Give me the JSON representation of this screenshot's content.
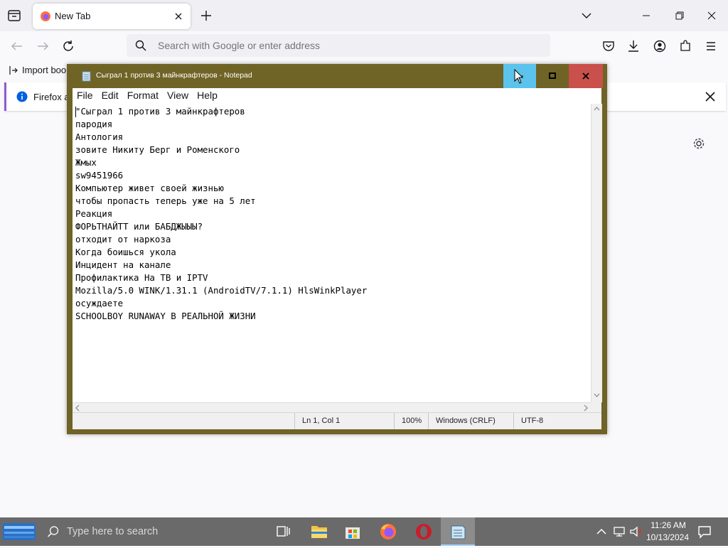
{
  "browser": {
    "tab_title": "New Tab",
    "search_placeholder": "Search with Google or enter address",
    "bookmarks_import_label": "Import bookmarks...",
    "bookmarks_import_visible": "Import boo",
    "notification_text": "Firefox au",
    "accent_color": "#8f5bd0"
  },
  "notepad": {
    "title": "Сыграл 1 против 3 майнкрафтеров - Notepad",
    "menus": [
      "File",
      "Edit",
      "Format",
      "View",
      "Help"
    ],
    "content": "\"Сыграл 1 против 3 майнкрафтеров\nпародия\nАнтология\nзовите Никиту Берг и Роменского\nЖмых\nsw9451966\nКомпьютер живет своей жизнью\nчтобы пропасть теперь уже на 5 лет\nРеакция\nФОРЬТНАЙТТ или БАБДЖЫЫЫ?\nотходит от наркоза\nКогда боишься укола\nИнцидент на канале\nПрофилактика На ТВ и IPTV\nMozilla/5.0 WINK/1.31.1 (AndroidTV/7.1.1) HlsWinkPlayer\nосуждаете\nSCHOOLBOY RUNAWAY В РЕАЛЬНОЙ ЖИЗНИ",
    "status": {
      "position": "Ln 1, Col 1",
      "zoom": "100%",
      "line_ending": "Windows (CRLF)",
      "encoding": "UTF-8"
    },
    "frame_color": "#6f6326"
  },
  "taskbar": {
    "search_placeholder": "Type here to search",
    "time": "11:26 AM",
    "date": "10/13/2024",
    "apps": [
      "task-view",
      "file-explorer",
      "microsoft-store",
      "firefox",
      "opera",
      "notepad"
    ]
  }
}
